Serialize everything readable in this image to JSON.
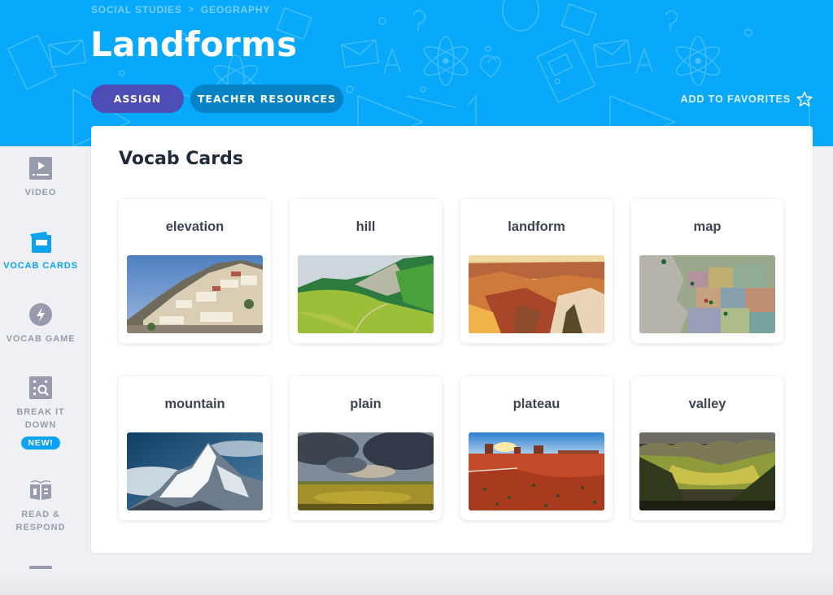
{
  "header": {
    "breadcrumb": [
      "SOCIAL STUDIES",
      "GEOGRAPHY"
    ],
    "breadcrumb_separator": ">",
    "title": "Landforms",
    "assign_label": "ASSIGN",
    "teacher_resources_label": "TEACHER RESOURCES",
    "favorites_label": "ADD TO FAVORITES",
    "favorites_icon": "star-outline-icon",
    "colors": {
      "banner": "#08a8fb",
      "assign": "#4e4cb5",
      "teacher": "#0682c7"
    }
  },
  "sidebar": {
    "items": [
      {
        "label": "VIDEO",
        "icon": "video-icon",
        "active": false
      },
      {
        "label": "VOCAB CARDS",
        "icon": "vocab-cards-icon",
        "active": true
      },
      {
        "label": "VOCAB GAME",
        "icon": "lightning-icon",
        "active": false
      },
      {
        "label": "BREAK IT DOWN",
        "icon": "break-it-down-icon",
        "active": false,
        "badge": "NEW!"
      },
      {
        "label": "READ & RESPOND",
        "icon": "open-book-icon",
        "active": false
      },
      {
        "label": "",
        "icon": "quiz-checklist-icon",
        "active": false
      }
    ],
    "active_color": "#0aa2f5",
    "inactive_color": "#969cad"
  },
  "main": {
    "section_title": "Vocab Cards",
    "cards": [
      {
        "word": "elevation",
        "image": "hillside-town-photo"
      },
      {
        "word": "hill",
        "image": "green-hill-photo"
      },
      {
        "word": "landform",
        "image": "canyon-photo"
      },
      {
        "word": "map",
        "image": "europe-map-photo"
      },
      {
        "word": "mountain",
        "image": "snowy-peak-photo"
      },
      {
        "word": "plain",
        "image": "grass-plain-photo"
      },
      {
        "word": "plateau",
        "image": "mesa-desert-photo"
      },
      {
        "word": "valley",
        "image": "green-valley-photo"
      }
    ]
  }
}
